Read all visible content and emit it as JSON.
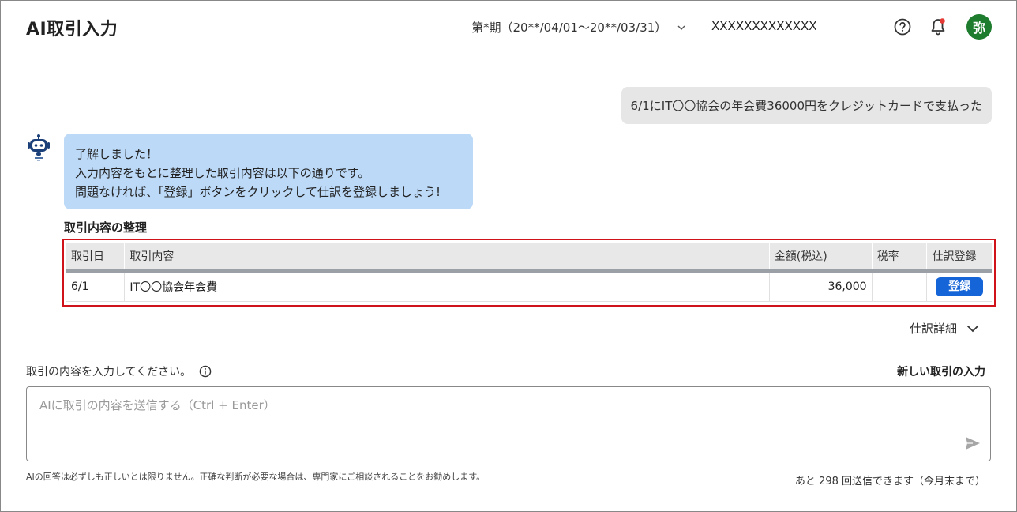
{
  "header": {
    "title": "AI取引入力",
    "period": "第*期（20**/04/01〜20**/03/31）",
    "company": "XXXXXXXXXXXXX",
    "avatar_text": "弥",
    "help_icon": "help-circle-icon",
    "bell_icon": "bell-icon",
    "notification_dot_color": "#e53935",
    "avatar_color": "#1e7c2e"
  },
  "chat": {
    "user_message": "6/1にIT〇〇協会の年会費36000円をクレジットカードで支払った",
    "bot_lines": [
      "了解しました！",
      "入力内容をもとに整理した取引内容は以下の通りです。",
      "問題なければ、「登録」ボタンをクリックして仕訳を登録しましょう!"
    ]
  },
  "summary": {
    "title": "取引内容の整理",
    "columns": [
      "取引日",
      "取引内容",
      "金額(税込)",
      "税率",
      "仕訳登録"
    ],
    "rows": [
      {
        "date": "6/1",
        "description": "IT〇〇協会年会費",
        "amount": "36,000",
        "tax_rate": "",
        "action": "登録"
      }
    ],
    "highlight_color": "#d0121b"
  },
  "detail_toggle": "仕訳詳細",
  "input": {
    "label": "取引の内容を入力してください。",
    "new_transaction": "新しい取引の入力",
    "placeholder": "AIに取引の内容を送信する（Ctrl + Enter）",
    "value": ""
  },
  "footer": {
    "disclaimer": "AIの回答は必ずしも正しいとは限りません。正確な判断が必要な場合は、専門家にご相談されることをお勧めします。",
    "remaining": "あと 298 回送信できます（今月末まで）"
  }
}
